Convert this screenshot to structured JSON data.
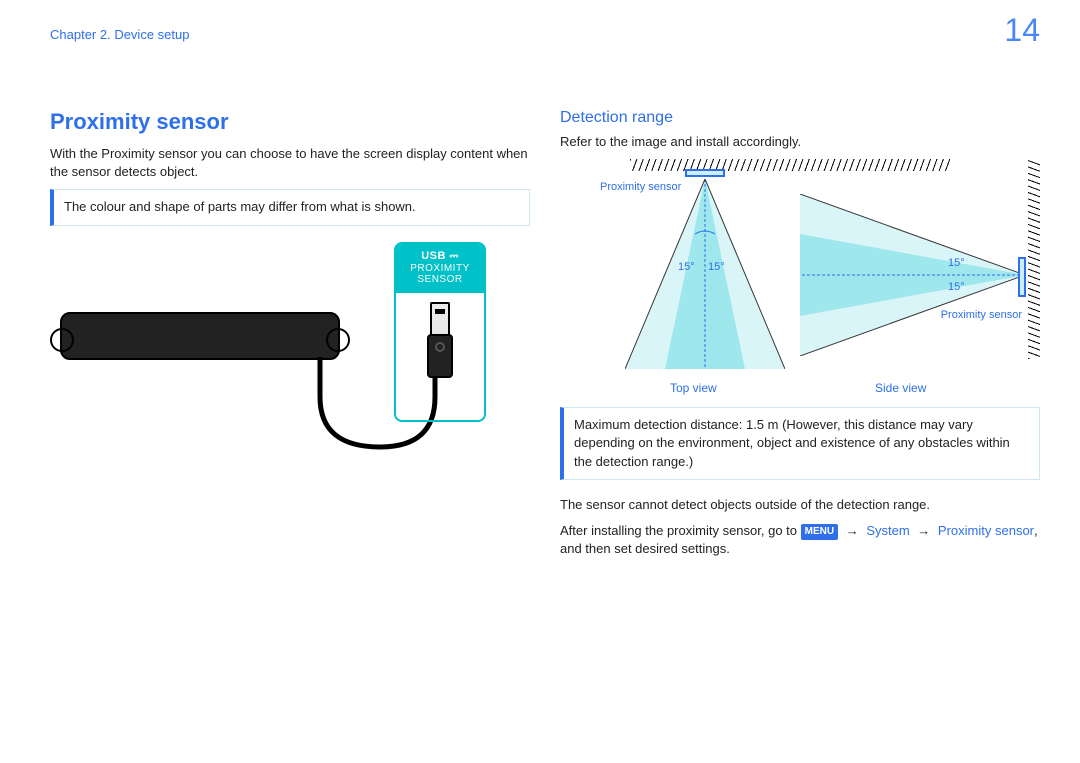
{
  "header": {
    "chapter": "Chapter 2. Device setup",
    "page_number": "14"
  },
  "left": {
    "title": "Proximity sensor",
    "intro": "With the Proximity sensor you can choose to have the screen display content when the sensor detects object.",
    "note": "The colour and shape of parts may differ from what is shown.",
    "usb_box": {
      "line1": "USB",
      "line2": "PROXIMITY",
      "line3": "SENSOR"
    }
  },
  "right": {
    "title": "Detection range",
    "intro": "Refer to the image and install accordingly.",
    "diagram": {
      "proximity_sensor_label": "Proximity sensor",
      "top_view_label": "Top view",
      "side_view_label": "Side view",
      "angle_15": "15°"
    },
    "max_distance_note": "Maximum detection distance: 1.5 m (However, this distance may vary depending on the environment, object and existence of any obstacles within the detection range.)",
    "cannot_detect": "The sensor cannot detect objects outside of the detection range.",
    "instructions": {
      "prefix": "After installing the proximity sensor, go to ",
      "menu_badge": "MENU",
      "arrow": "→",
      "path_system": "System",
      "path_proximity": "Proximity sensor",
      "suffix": ", and then set desired settings."
    }
  }
}
